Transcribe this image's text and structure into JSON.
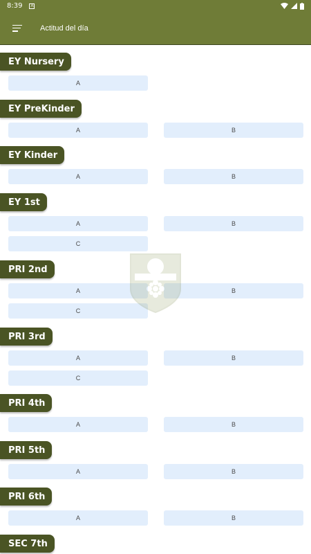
{
  "status_bar": {
    "time": "8:39",
    "notification_glyph": "A"
  },
  "app_bar": {
    "title": "Actitud del día"
  },
  "sections": [
    {
      "label": "EY Nursery",
      "groups": [
        "A"
      ]
    },
    {
      "label": "EY PreKinder",
      "groups": [
        "A",
        "B"
      ]
    },
    {
      "label": "EY Kinder",
      "groups": [
        "A",
        "B"
      ]
    },
    {
      "label": "EY 1st",
      "groups": [
        "A",
        "B",
        "C"
      ]
    },
    {
      "label": "PRI 2nd",
      "groups": [
        "A",
        "B",
        "C"
      ]
    },
    {
      "label": "PRI 3rd",
      "groups": [
        "A",
        "B",
        "C"
      ]
    },
    {
      "label": "PRI 4th",
      "groups": [
        "A",
        "B"
      ]
    },
    {
      "label": "PRI 5th",
      "groups": [
        "A",
        "B"
      ]
    },
    {
      "label": "PRI 6th",
      "groups": [
        "A",
        "B"
      ]
    },
    {
      "label": "SEC 7th",
      "groups": []
    }
  ],
  "colors": {
    "app_bar": "#6f7c37",
    "label_bg": "#4a5424",
    "group_bg": "#e2eefc"
  }
}
